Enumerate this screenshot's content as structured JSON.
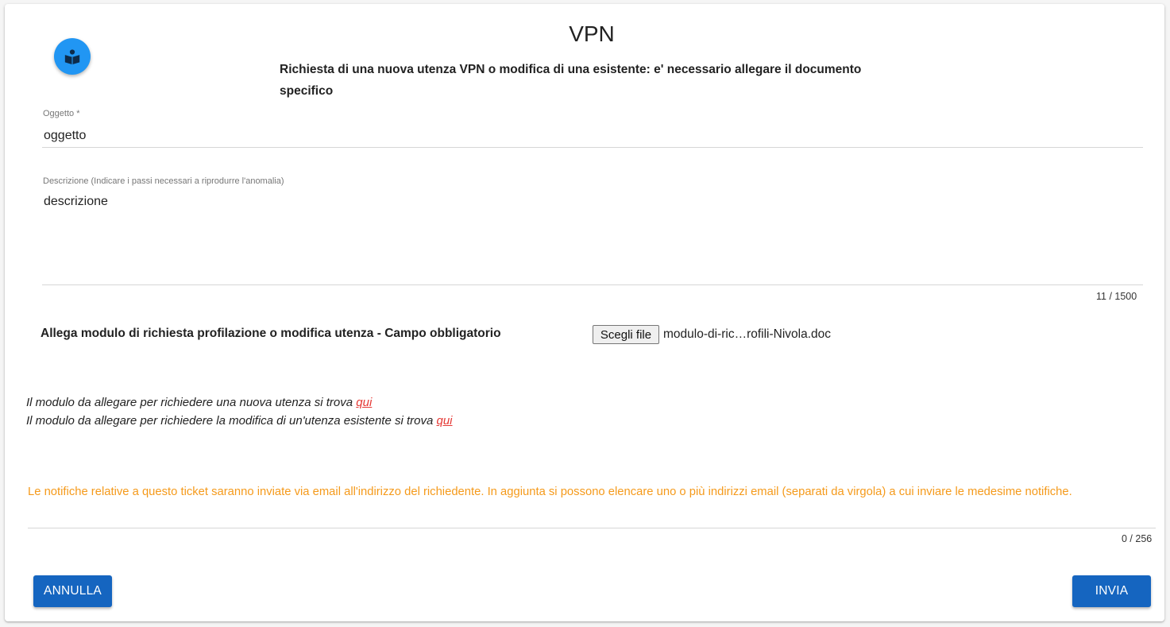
{
  "header": {
    "title": "VPN",
    "subtitle": "Richiesta di una nuova utenza VPN o modifica di una esistente: e' necessario allegare il documento specifico",
    "logo_icon": "book-reader-icon"
  },
  "form": {
    "oggetto": {
      "label": "Oggetto *",
      "value": "oggetto"
    },
    "descrizione": {
      "label": "Descrizione (Indicare i passi necessari a riprodurre l'anomalia)",
      "value": "descrizione",
      "counter": "11 / 1500"
    },
    "attachment": {
      "label": "Allega modulo di richiesta profilazione o modifica utenza - Campo obbligatorio",
      "button_label": "Scegli file",
      "file_name": "modulo-di-ric…rofili-Nivola.doc"
    },
    "info": {
      "line1_text": "Il modulo da allegare per richiedere una nuova utenza si trova",
      "line1_link": "qui",
      "line2_text": "Il modulo da allegare per richiedere la modifica di un'utenza esistente si trova",
      "line2_link": "qui"
    },
    "notifications": {
      "label": "Le notifiche relative a questo ticket saranno inviate via email all'indirizzo del richiedente. In aggiunta si possono elencare uno o più indirizzi email (separati da virgola) a cui inviare le medesime notifiche.",
      "value": "",
      "counter": "0 / 256"
    }
  },
  "actions": {
    "cancel_label": "ANNULLA",
    "submit_label": "INVIA"
  },
  "colors": {
    "primary": "#1565c0",
    "logo": "#2196f3",
    "link": "#e53935",
    "notice": "#f59a1b"
  }
}
